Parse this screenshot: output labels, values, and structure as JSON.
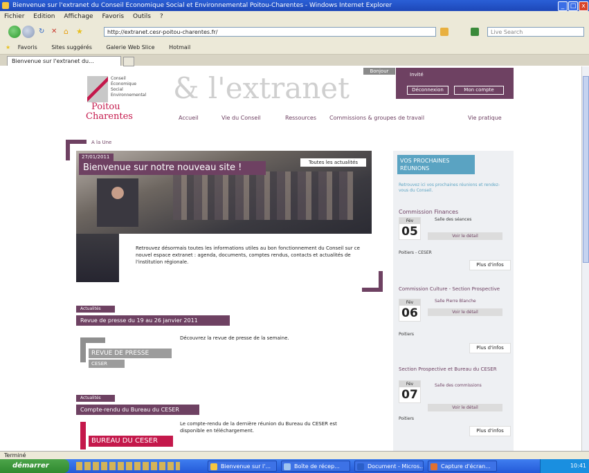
{
  "window": {
    "title": "Bienvenue sur l'extranet du Conseil Economique Social et Environnemental Poitou-Charentes - Windows Internet Explorer",
    "controls": [
      "_",
      "□",
      "x"
    ]
  },
  "menu": [
    "Fichier",
    "Edition",
    "Affichage",
    "Favoris",
    "Outils",
    "?"
  ],
  "address": {
    "url": "http://extranet.cesr-poitou-charentes.fr/",
    "search_placeholder": "Live Search"
  },
  "links_bar": [
    "Favoris",
    "Sites suggérés",
    "Galerie Web Slice",
    "Hotmail"
  ],
  "tabs": [
    {
      "label": "Bienvenue sur l'extranet du..."
    }
  ],
  "site": {
    "logo": {
      "line1": "Conseil",
      "line2": "Économique",
      "line3": "Social",
      "line4": "Environnemental",
      "region1": "Poitou",
      "region2": "Charentes"
    },
    "banner": "& l'extranet",
    "login": {
      "label": "Bonjour",
      "user": "Invité",
      "btn1": "Déconnexion",
      "btn2": "Mon compte"
    },
    "nav": [
      "Accueil",
      "Vie du Conseil",
      "Ressources",
      "Commissions & groupes de travail",
      "Vie pratique"
    ],
    "feature": {
      "section": "A la Une",
      "date": "27/01/2011",
      "title": "Bienvenue sur notre nouveau site !",
      "all_news": "Toutes les actualités",
      "body": "Retrouvez désormais toutes les informations utiles au bon fonctionnement du Conseil sur ce nouvel espace extranet : agenda, documents, comptes rendus, contacts et actualités de l'institution régionale."
    },
    "articles": [
      {
        "tag": "Actualités",
        "title": "Revue de presse du 19 au 26 janvier 2011",
        "body": "Découvrez la revue de presse de la semaine.",
        "image": "REVUE DE PRESSE",
        "image_sub": "CESER"
      },
      {
        "tag": "Actualités",
        "title": "Compte-rendu du Bureau du CESER",
        "body": "Le compte-rendu de la dernière réunion du Bureau du CESER est disponible en téléchargement.",
        "image": "BUREAU DU CESER"
      }
    ],
    "sidebar": {
      "heading": "VOS PROCHAINES RÉUNIONS",
      "intro": "Retrouvez ici vos prochaines réunions et rendez-vous du Conseil.",
      "events": [
        {
          "title": "Commission Finances",
          "month": "Fév",
          "day": "05",
          "line": "Salle des séances",
          "btn": "Voir le détail",
          "loc": "Poitiers - CESER",
          "more": "Plus d'infos"
        },
        {
          "title": "Commission Culture - Section Prospective",
          "month": "Fév",
          "day": "06",
          "line": "Salle Pierre Blanche",
          "btn": "Voir le détail",
          "loc": "Poitiers",
          "more": "Plus d'infos"
        },
        {
          "title": "Section Prospective et Bureau du CESER",
          "month": "Fév",
          "day": "07",
          "line": "Salle des commissions",
          "btn": "Voir le détail",
          "loc": "Poitiers",
          "more": "Plus d'infos"
        }
      ]
    }
  },
  "status": {
    "text": "Terminé"
  },
  "taskbar": {
    "start": "démarrer",
    "items": [
      "Bienvenue sur l'...",
      "Boîte de récep...",
      "Document - Micros...",
      "Capture d'écran..."
    ],
    "clock": "10:41"
  }
}
